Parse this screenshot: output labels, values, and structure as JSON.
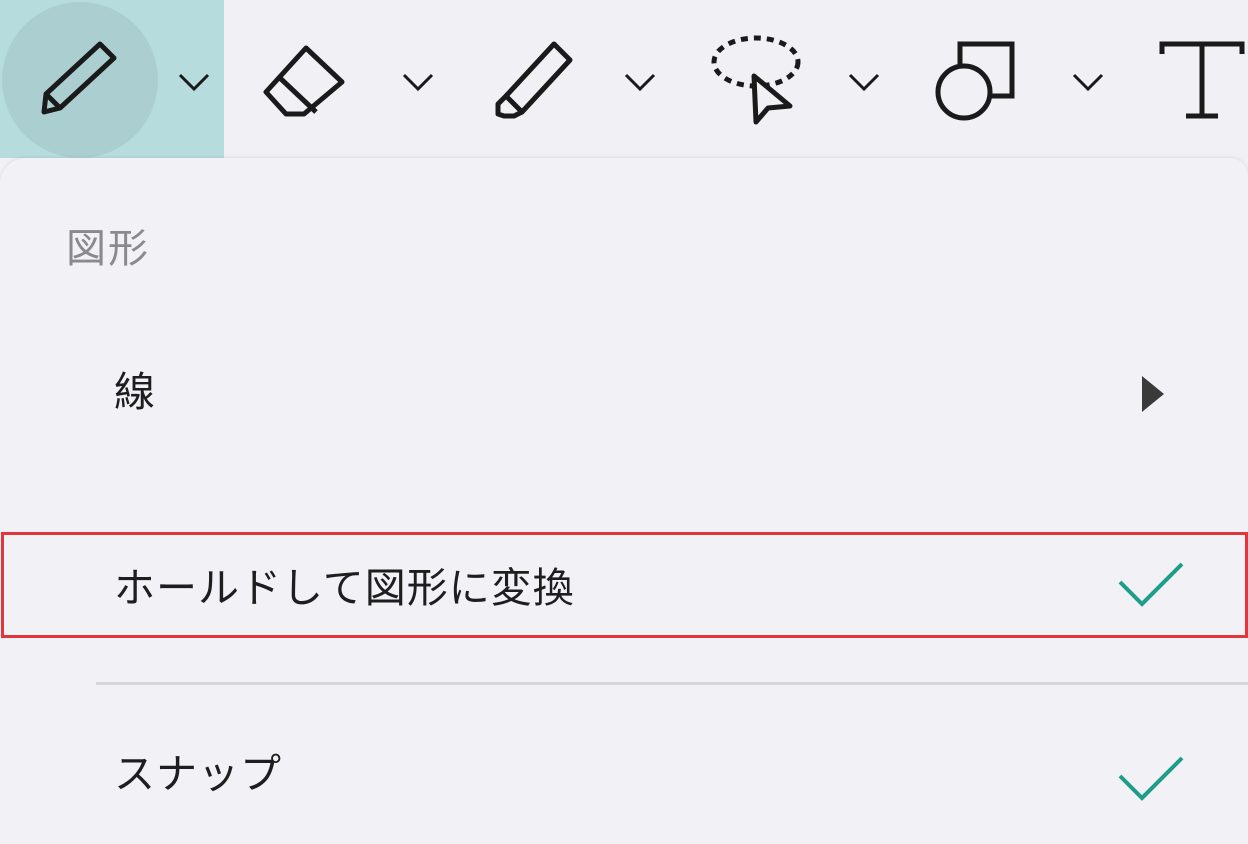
{
  "toolbar": {
    "tools": [
      {
        "name": "pen",
        "icon": "pencil-icon",
        "active": true
      },
      {
        "name": "eraser",
        "icon": "eraser-icon",
        "active": false
      },
      {
        "name": "highlighter",
        "icon": "highlighter-icon",
        "active": false
      },
      {
        "name": "lasso-select",
        "icon": "lasso-select-icon",
        "active": false
      },
      {
        "name": "shapes",
        "icon": "shapes-icon",
        "active": false
      },
      {
        "name": "text",
        "icon": "text-icon",
        "active": false
      }
    ]
  },
  "menu": {
    "section_header": "図形",
    "items": [
      {
        "label": "線",
        "has_submenu": true
      },
      {
        "label": "ホールドして図形に変換",
        "checked": true
      },
      {
        "label": "スナップ",
        "checked": true
      }
    ]
  },
  "colors": {
    "active_tool_bg": "#b7dcdd",
    "check_color": "#1e9d8b",
    "highlight_border": "#e0363c"
  }
}
